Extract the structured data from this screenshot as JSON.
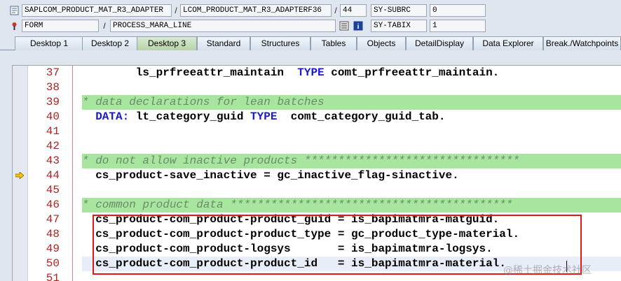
{
  "header": {
    "row1": {
      "program": "SAPLCOM_PRODUCT_MAT_R3_ADAPTER",
      "include": "LCOM_PRODUCT_MAT_R3_ADAPTERF36",
      "line": "44",
      "sys_field": "SY-SUBRC",
      "sys_value": "0"
    },
    "row2": {
      "type": "FORM",
      "name": "PROCESS_MARA_LINE",
      "sys_field": "SY-TABIX",
      "sys_value": "1"
    }
  },
  "tabs": [
    {
      "label": "Desktop 1",
      "active": false
    },
    {
      "label": "Desktop 2",
      "active": false
    },
    {
      "label": "Desktop 3",
      "active": true
    },
    {
      "label": "Standard",
      "active": false
    },
    {
      "label": "Structures",
      "active": false
    },
    {
      "label": "Tables",
      "active": false
    },
    {
      "label": "Objects",
      "active": false
    },
    {
      "label": "DetailDisplay",
      "active": false
    },
    {
      "label": "Data Explorer",
      "active": false
    },
    {
      "label": "Break./Watchpoints",
      "active": false
    }
  ],
  "code_lines": [
    {
      "num": "37",
      "text": "ls_prfreeattr_maintain  TYPE comt_prfreeattr_maintain.",
      "indent": 4
    },
    {
      "num": "38",
      "text": "",
      "indent": 0
    },
    {
      "num": "39",
      "text": "* data declarations for lean batches",
      "comment": true,
      "indent": 0
    },
    {
      "num": "40",
      "text": "DATA: lt_category_guid TYPE  comt_category_guid_tab.",
      "indent": 1
    },
    {
      "num": "41",
      "text": "",
      "indent": 0
    },
    {
      "num": "42",
      "text": "",
      "indent": 0
    },
    {
      "num": "43",
      "text": "* do not allow inactive products ********************************",
      "comment": true,
      "indent": 0
    },
    {
      "num": "44",
      "text": "cs_product-save_inactive = gc_inactive_flag-sinactive.",
      "indent": 1,
      "current": true
    },
    {
      "num": "45",
      "text": "",
      "indent": 0
    },
    {
      "num": "46",
      "text": "* common product data ******************************************",
      "comment": true,
      "indent": 0
    },
    {
      "num": "47",
      "text": "cs_product-com_product-product_guid = is_bapimatmra-matguid.",
      "indent": 1
    },
    {
      "num": "48",
      "text": "cs_product-com_product-product_type = gc_product_type-material.",
      "indent": 1
    },
    {
      "num": "49",
      "text": "cs_product-com_product-logsys       = is_bapimatmra-logsys.",
      "indent": 1
    },
    {
      "num": "50",
      "text": "cs_product-com_product-product_id   = is_bapimatmra-material.",
      "indent": 1,
      "cursor": true
    },
    {
      "num": "51",
      "text": "",
      "indent": 0
    }
  ],
  "watermark": "@稀土掘金技术社区",
  "colors": {
    "comment_bg": "#a8e6a0",
    "keyword": "#1a1acb",
    "line_number": "#b22222",
    "highlight_box": "#e01818"
  }
}
